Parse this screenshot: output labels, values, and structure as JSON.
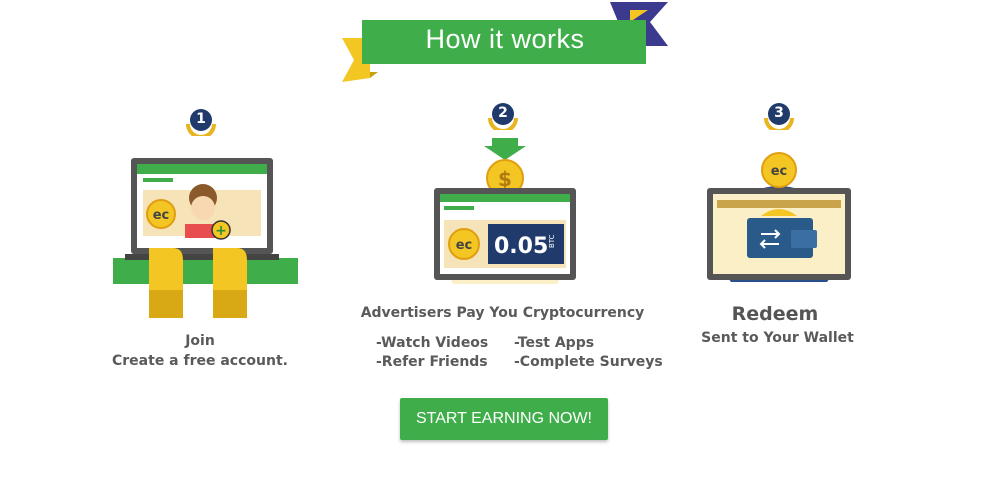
{
  "banner": {
    "title": "How it works"
  },
  "steps": [
    {
      "number": "1",
      "title": "Join",
      "subtitle": "Create a free account."
    },
    {
      "number": "2",
      "title": "Advertisers Pay You Cryptocurrency",
      "items": [
        "-Watch Videos",
        "-Test Apps",
        "-Refer Friends",
        "-Complete Surveys"
      ],
      "amount": "0.05",
      "amount_unit": "BTC"
    },
    {
      "number": "3",
      "title": "Redeem",
      "subtitle": "Sent to Your Wallet"
    }
  ],
  "coin": {
    "label": "ec"
  },
  "cta": {
    "label": "START EARNING NOW!"
  },
  "colors": {
    "green": "#3fae4a",
    "navy": "#1f3a6b",
    "yellow": "#f3c623",
    "gold": "#e8b520",
    "grey": "#555555"
  }
}
